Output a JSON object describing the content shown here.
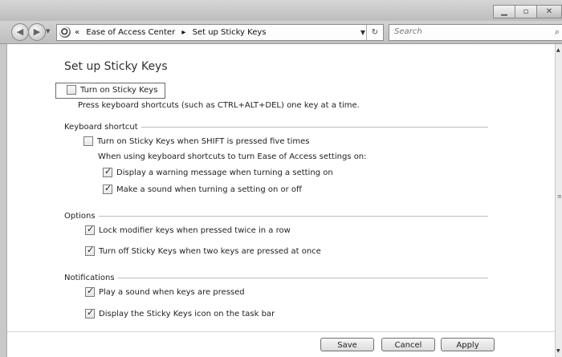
{
  "window": {
    "controls": {
      "minimize": "minimize-icon",
      "maximize": "maximize-icon",
      "close": "close-icon"
    }
  },
  "address": {
    "crumb_prefix": "«",
    "crumbs": [
      "Ease of Access Center",
      "Set up Sticky Keys"
    ],
    "separator": "▸"
  },
  "search": {
    "placeholder": "Search"
  },
  "page": {
    "title": "Set up Sticky Keys",
    "main_toggle": {
      "label": "Turn on Sticky Keys",
      "checked": false
    },
    "main_description": "Press keyboard shortcuts (such as CTRL+ALT+DEL) one key at a time.",
    "keyboard_shortcut": {
      "heading": "Keyboard shortcut",
      "shift_toggle": {
        "label": "Turn on Sticky Keys when SHIFT is pressed five times",
        "checked": false
      },
      "note": "When using keyboard shortcuts to turn Ease of Access settings on:",
      "warning": {
        "label": "Display a warning message when turning a setting on",
        "checked": true
      },
      "sound": {
        "label": "Make a sound when turning a setting on or off",
        "checked": true
      }
    },
    "options": {
      "heading": "Options",
      "lock_modifier": {
        "label": "Lock modifier keys when pressed twice in a row",
        "checked": true
      },
      "turn_off": {
        "label": "Turn off Sticky Keys when two keys are pressed at once",
        "checked": true
      }
    },
    "notifications": {
      "heading": "Notifications",
      "play_sound": {
        "label": "Play a sound when keys are pressed",
        "checked": true
      },
      "taskbar_icon": {
        "label": "Display the Sticky Keys icon on the task bar",
        "checked": true
      }
    }
  },
  "footer": {
    "save": "Save",
    "cancel": "Cancel",
    "apply": "Apply"
  }
}
